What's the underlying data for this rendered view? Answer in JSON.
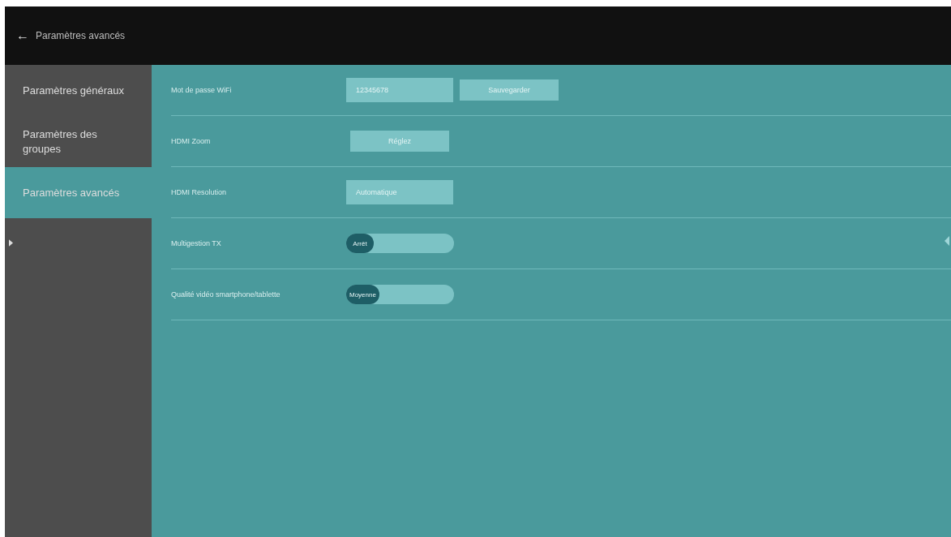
{
  "header": {
    "back_icon": "←",
    "title": "Paramètres avancés"
  },
  "sidebar": {
    "items": [
      {
        "label": "Paramètres généraux",
        "selected": false
      },
      {
        "label": "Paramètres des groupes",
        "selected": false
      },
      {
        "label": "Paramètres avancés",
        "selected": true
      }
    ]
  },
  "settings": [
    {
      "kind": "field_button",
      "label": "Mot de passe WiFi",
      "value": "12345678",
      "button": "Sauvegarder"
    },
    {
      "kind": "button",
      "label": "HDMI Zoom",
      "button": "Réglez"
    },
    {
      "kind": "field",
      "label": "HDMI Resolution",
      "value": "Automatique"
    },
    {
      "kind": "toggle",
      "label": "Multigestion TX",
      "value": "Arrêt",
      "on": false
    },
    {
      "kind": "toggle",
      "label": "Qualité vidéo smartphone/tablette",
      "value": "Moyenne",
      "on": false
    }
  ]
}
